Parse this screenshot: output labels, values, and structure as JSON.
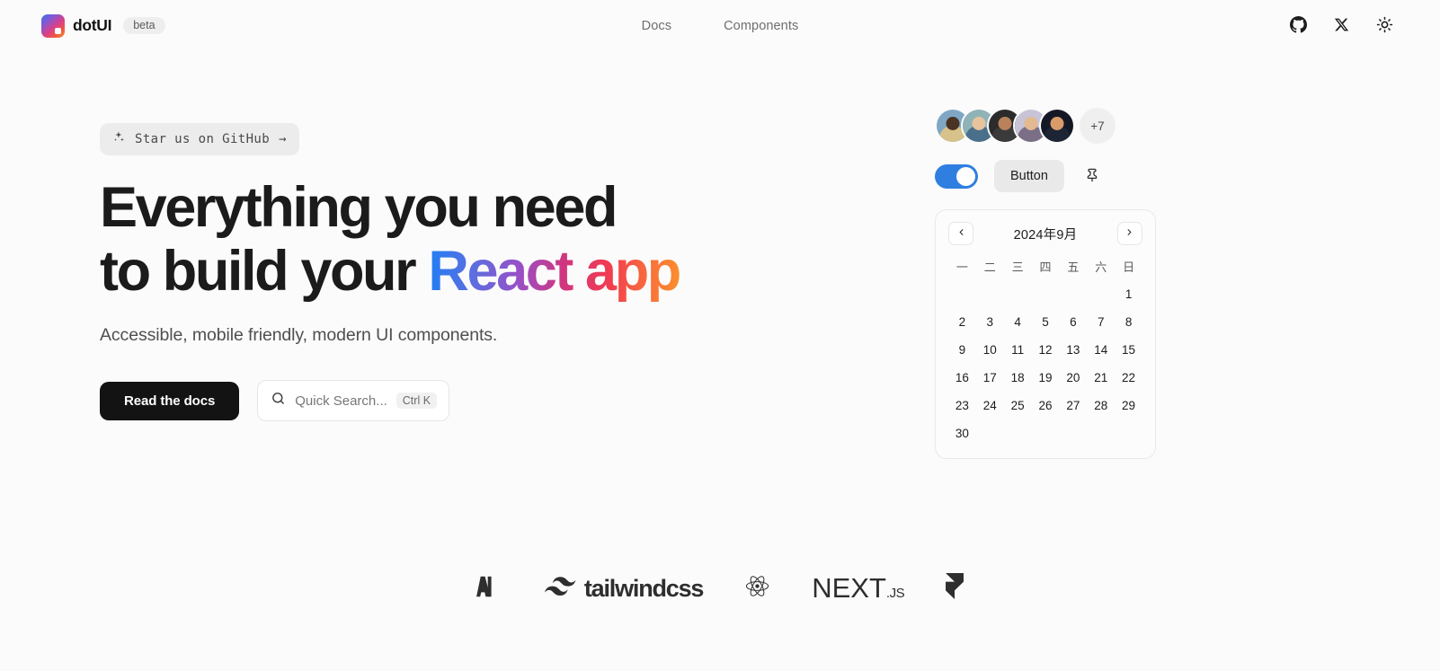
{
  "header": {
    "brand_name": "dotUI",
    "brand_badge": "beta",
    "logo_icon": "dotui-logo-icon",
    "nav": [
      {
        "label": "Docs"
      },
      {
        "label": "Components"
      }
    ],
    "actions": [
      {
        "icon": "github-icon",
        "label": "GitHub"
      },
      {
        "icon": "x-twitter-icon",
        "label": "X"
      },
      {
        "icon": "sun-theme-icon",
        "label": "Toggle theme"
      }
    ]
  },
  "hero": {
    "badge": {
      "icon": "sparkles-icon",
      "label": "Star us on GitHub",
      "arrow": "→"
    },
    "title_line1": "Everything you need",
    "title_line2_plain": "to build your ",
    "title_line2_gradient": "React app",
    "subtitle": "Accessible, mobile friendly, modern UI components.",
    "primary_button": "Read the docs",
    "search": {
      "icon": "search-icon",
      "placeholder": "Quick Search...",
      "shortcut": "Ctrl K"
    },
    "gradient_colors": [
      "#1f7ef5",
      "#9750c8",
      "#d0367e",
      "#f23b50",
      "#fb8f2e"
    ]
  },
  "showcase": {
    "avatars": [
      {
        "name": "avatar-1",
        "bg": "#7fa7c4",
        "skin": "#4b3324",
        "shirt": "#d6c28a"
      },
      {
        "name": "avatar-2",
        "bg": "#8fb3b7",
        "skin": "#e8c39e",
        "shirt": "#4a6f8a"
      },
      {
        "name": "avatar-3",
        "bg": "#2b2b2b",
        "skin": "#b9825c",
        "shirt": "#3a3a3a"
      },
      {
        "name": "avatar-4",
        "bg": "#c8c3d6",
        "skin": "#e3b98f",
        "shirt": "#7b6f88"
      },
      {
        "name": "avatar-5",
        "bg": "#141826",
        "skin": "#d99b6a",
        "shirt": "#1d2433"
      }
    ],
    "avatar_overflow": "+7",
    "toggle": {
      "name": "feature-toggle",
      "state": "on",
      "color": "#2f7fe0"
    },
    "button_label": "Button",
    "pin_icon": "pin-icon"
  },
  "calendar": {
    "prev_icon": "chevron-left-icon",
    "next_icon": "chevron-right-icon",
    "title": "2024年9月",
    "weekdays": [
      "一",
      "二",
      "三",
      "四",
      "五",
      "六",
      "日"
    ],
    "leading_blanks": 6,
    "days": [
      1,
      2,
      3,
      4,
      5,
      6,
      7,
      8,
      9,
      10,
      11,
      12,
      13,
      14,
      15,
      16,
      17,
      18,
      19,
      20,
      21,
      22,
      23,
      24,
      25,
      26,
      27,
      28,
      29,
      30
    ]
  },
  "logo_strip": [
    {
      "name": "react-aria-logo",
      "type": "icon",
      "label": "React Aria"
    },
    {
      "name": "tailwindcss-logo",
      "type": "icon-word",
      "label": "tailwindcss"
    },
    {
      "name": "react-logo",
      "type": "icon",
      "label": "React"
    },
    {
      "name": "nextjs-logo",
      "type": "word",
      "label": "NEXT",
      "suffix": ".JS"
    },
    {
      "name": "framer-logo",
      "type": "icon",
      "label": "Framer"
    }
  ]
}
